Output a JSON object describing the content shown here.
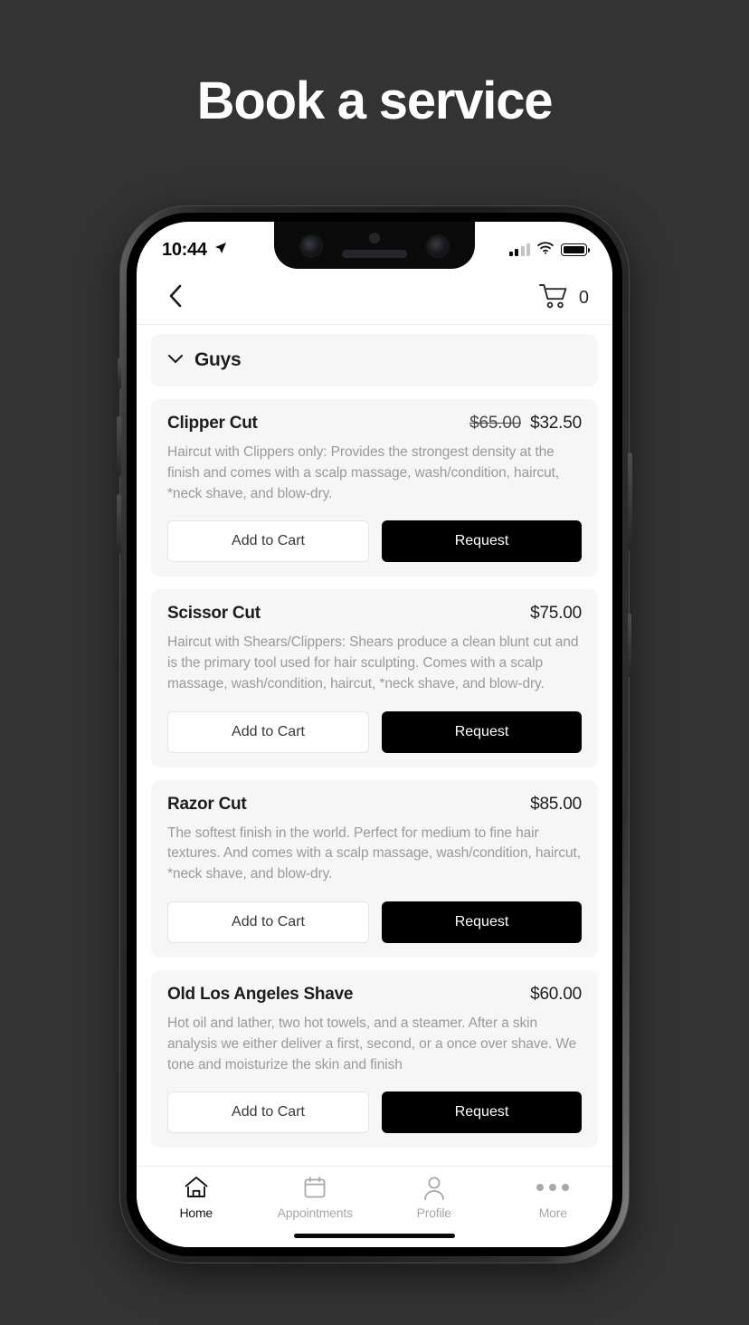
{
  "headline": "Book a service",
  "status_bar": {
    "time": "10:44",
    "location_icon": "location-arrow-icon",
    "signal_icon": "cellular-signal-icon",
    "signal_bars_filled": 2,
    "signal_bars_total": 4,
    "wifi_icon": "wifi-icon",
    "battery_icon": "battery-full-icon"
  },
  "navbar": {
    "back_icon": "chevron-left-icon",
    "cart_icon": "shopping-cart-icon",
    "cart_count": "0"
  },
  "category": {
    "label": "Guys",
    "chevron_icon": "chevron-down-icon",
    "expanded": true
  },
  "buttons": {
    "add_to_cart": "Add to Cart",
    "request": "Request"
  },
  "services": [
    {
      "name": "Clipper Cut",
      "old_price": "$65.00",
      "price": "$32.50",
      "description": "Haircut with Clippers only: Provides the strongest density at the finish and comes with a scalp massage, wash/condition, haircut, *neck shave, and blow-dry."
    },
    {
      "name": "Scissor Cut",
      "old_price": "",
      "price": "$75.00",
      "description": "Haircut with Shears/Clippers: Shears produce a clean blunt cut and is the primary tool used for hair sculpting. Comes with a scalp massage, wash/condition, haircut, *neck shave, and blow-dry."
    },
    {
      "name": "Razor Cut",
      "old_price": "",
      "price": "$85.00",
      "description": "The softest finish in the world. Perfect for medium to fine hair textures. And comes with a scalp massage, wash/condition, haircut, *neck shave, and blow-dry."
    },
    {
      "name": "Old Los Angeles Shave",
      "old_price": "",
      "price": "$60.00",
      "description": "Hot oil and lather, two hot towels, and a steamer. After a skin analysis we either deliver a first, second, or a once over shave. We tone and moisturize the skin and finish"
    }
  ],
  "tabbar": [
    {
      "label": "Home",
      "icon": "home-icon",
      "active": true
    },
    {
      "label": "Appointments",
      "icon": "calendar-icon",
      "active": false
    },
    {
      "label": "Profile",
      "icon": "person-icon",
      "active": false
    },
    {
      "label": "More",
      "icon": "ellipsis-icon",
      "active": false
    }
  ],
  "colors": {
    "background": "#333333",
    "card": "#f6f6f6",
    "accent_dark": "#000000",
    "muted_text": "#9a9a9a"
  }
}
